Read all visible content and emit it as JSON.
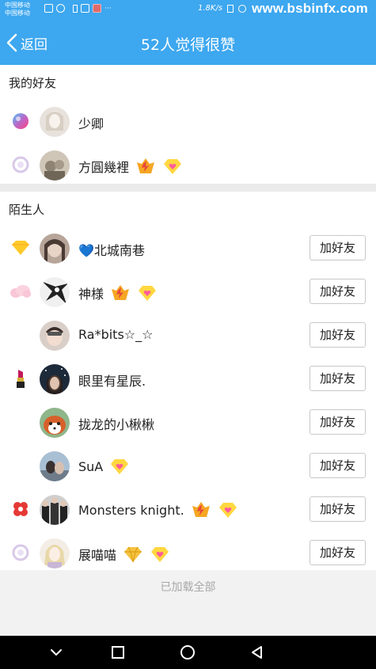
{
  "status_bar": {
    "carrier_1": "中国移动",
    "carrier_2": "中国移动",
    "notif_more": "···",
    "speed": "1.8K/s",
    "watermark": "www.bsbinfx.com"
  },
  "header": {
    "back_label": "返回",
    "title": "52人觉得很赞"
  },
  "friends": {
    "section_title": "我的好友",
    "items": [
      {
        "name": "少卿",
        "lead_icon": "colorful-orb-icon",
        "badges": []
      },
      {
        "name": "方圓幾裡",
        "lead_icon": "ring-icon",
        "badges": [
          "flame-vip-badge-icon",
          "diamond-heart-badge-icon"
        ]
      }
    ]
  },
  "strangers": {
    "section_title": "陌生人",
    "add_label": "加好友",
    "items": [
      {
        "name": "💙北城南巷",
        "lead_icon": "diamond-icon",
        "badges": []
      },
      {
        "name": "神様",
        "lead_icon": "pink-cloud-icon",
        "badges": [
          "flame-vip-badge-icon",
          "diamond-heart-badge-icon"
        ]
      },
      {
        "name": "Ra*bits☆_☆",
        "lead_icon": "",
        "badges": []
      },
      {
        "name": "眼里有星辰.",
        "lead_icon": "lipstick-icon",
        "badges": []
      },
      {
        "name": "拢龙的小楸楸",
        "lead_icon": "",
        "badges": []
      },
      {
        "name": "SuA",
        "lead_icon": "",
        "badges": [
          "diamond-heart-badge-icon"
        ]
      },
      {
        "name": "Monsters knight.",
        "lead_icon": "red-knot-icon",
        "badges": [
          "flame-vip-badge-icon",
          "diamond-heart-badge-icon"
        ]
      },
      {
        "name": "展喵喵",
        "lead_icon": "ring-icon",
        "badges": [
          "gold-diamond-badge-icon",
          "diamond-heart-badge-icon"
        ]
      }
    ]
  },
  "footer": {
    "loaded_all": "已加载全部"
  },
  "colors": {
    "header_blue": "#3da7ef",
    "navbar": "#000000",
    "footer_text": "#a8a8a8"
  }
}
